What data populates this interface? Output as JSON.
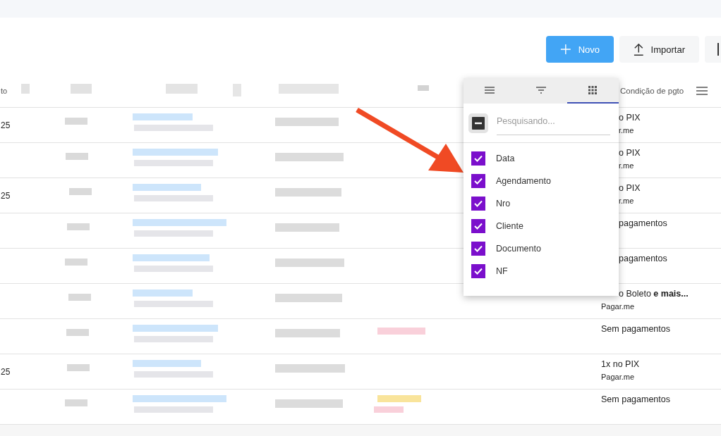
{
  "toolbar": {
    "buttons": [
      {
        "label": "Novo",
        "kind": "primary"
      },
      {
        "label": "Importar",
        "kind": "import"
      },
      {
        "kind": "cut"
      }
    ]
  },
  "table": {
    "columns": [
      {
        "label": "to"
      },
      {
        "label": "Condição de pgto"
      }
    ],
    "rows": [
      {
        "column_1": "25",
        "payment": "o PIX",
        "gateway": "r.me",
        "kind": "clipped"
      },
      {
        "payment": "o PIX",
        "gateway": "r.me",
        "kind": "clipped"
      },
      {
        "column_1": "25",
        "payment": "o PIX",
        "gateway": "r.me",
        "kind": "clipped"
      },
      {
        "payment": "pagamentos",
        "kind": "clipped"
      },
      {
        "payment": "pagamentos",
        "kind": "clipped"
      },
      {
        "payment": "o Boleto **e mais...**",
        "gateway": "Pagar.me",
        "kind": "clipped_first"
      },
      {
        "payment": "Sem pagamentos",
        "kind": "full"
      },
      {
        "column_1": "25",
        "payment": "1x no PIX",
        "gateway": "Pagar.me",
        "kind": "full"
      },
      {
        "payment": "Sem pagamentos",
        "kind": "full"
      }
    ]
  },
  "column_menu": {
    "tabs": [
      {
        "kind": "menu",
        "selected": false
      },
      {
        "kind": "filter",
        "selected": false
      },
      {
        "kind": "columns",
        "selected": true
      }
    ],
    "select_all": {
      "indeterminate": true
    },
    "search": {
      "placeholder": "Pesquisando..."
    },
    "items": [
      {
        "label": "Data",
        "checked": true
      },
      {
        "label": "Agendamento",
        "checked": true
      },
      {
        "label": "Nro",
        "checked": true
      },
      {
        "label": "Cliente",
        "checked": true
      },
      {
        "label": "Documento",
        "checked": true
      },
      {
        "label": "NF",
        "checked": true
      }
    ]
  }
}
